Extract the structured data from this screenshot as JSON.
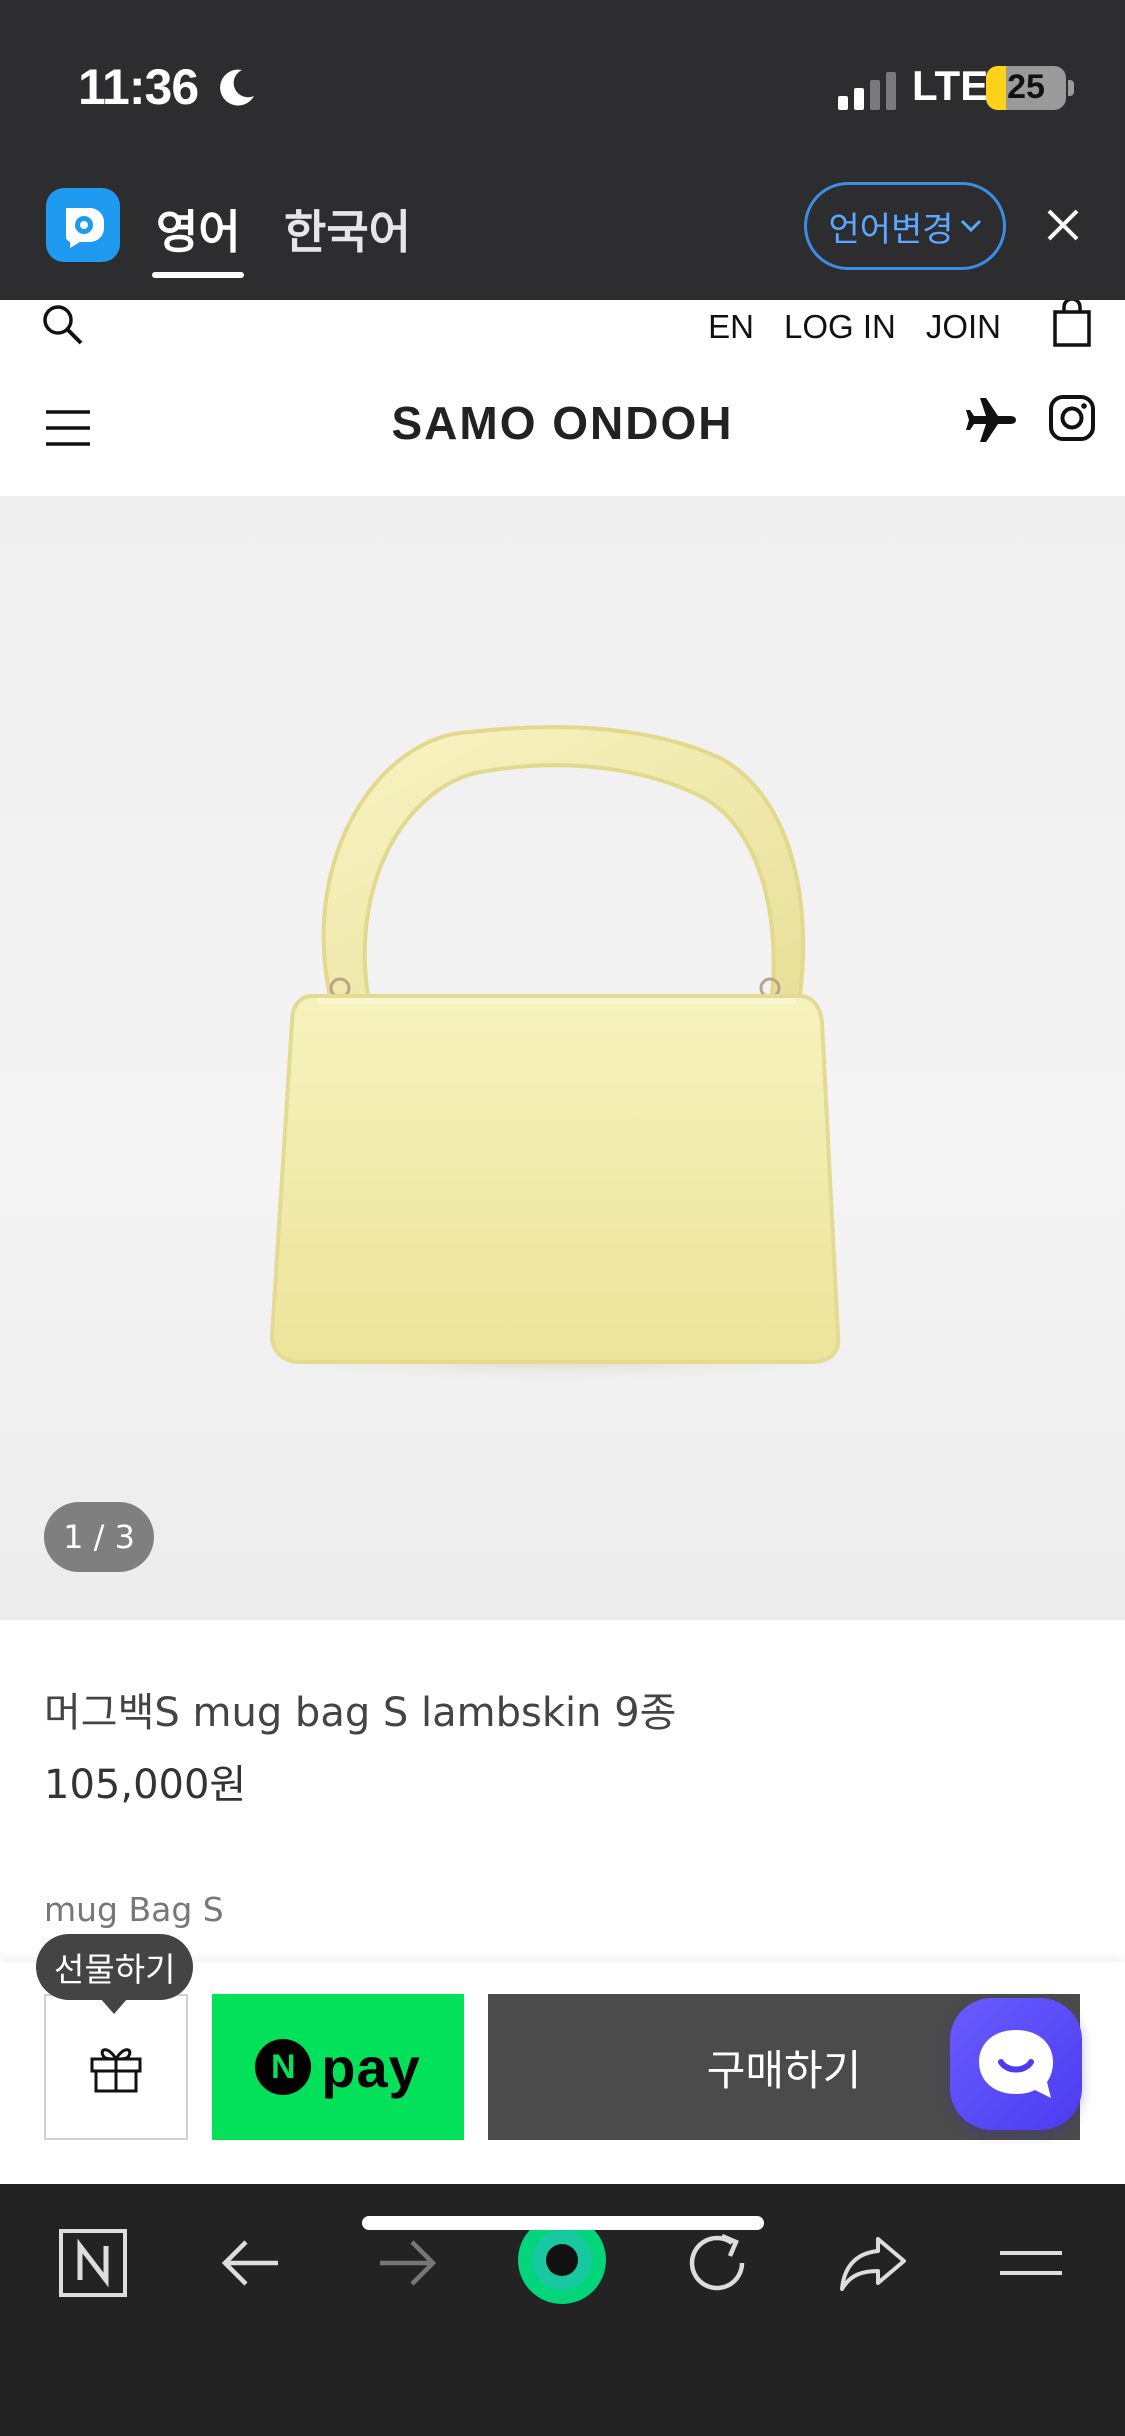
{
  "status_bar": {
    "time": "11:36",
    "network": "LTE",
    "battery_level": "25",
    "battery_fraction": 0.25
  },
  "translate_bar": {
    "tab_english": "영어",
    "tab_korean": "한국어",
    "change_language": "언어변경",
    "accent_color": "#3a8ee6"
  },
  "header": {
    "links": [
      "EN",
      "LOG IN",
      "JOIN"
    ],
    "brand": "SAMO ONDOH"
  },
  "product": {
    "image_counter": "1 / 3",
    "name": "머그백S mug bag S lambskin 9종",
    "price": "105,000원",
    "subtitle": "mug Bag S",
    "bag_color": "#f3eeb0"
  },
  "purchase": {
    "gift_tooltip": "선물하기",
    "npay_n": "N",
    "npay_label": "pay",
    "buy_label": "구매하기",
    "npay_color": "#03e15a"
  },
  "browser_toolbar": {
    "icons": [
      "naver-home-icon",
      "back-arrow-icon",
      "forward-arrow-icon",
      "green-dot-icon",
      "refresh-icon",
      "share-icon",
      "menu-icon"
    ]
  }
}
